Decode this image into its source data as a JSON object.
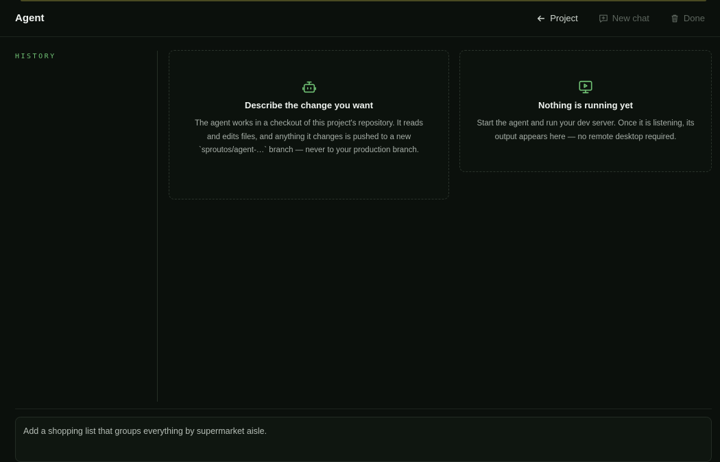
{
  "header": {
    "title": "Agent",
    "actions": {
      "project_label": "Project",
      "new_chat_label": "New chat",
      "done_label": "Done"
    }
  },
  "sidebar": {
    "history_label": "HISTORY"
  },
  "cards": {
    "describe": {
      "icon": "robot-icon",
      "title": "Describe the change you want",
      "body": "The agent works in a checkout of this project's repository. It reads and edits files, and anything it changes is pushed to a new `sproutos/agent-…` branch — never to your production branch."
    },
    "running": {
      "icon": "monitor-play-icon",
      "title": "Nothing is running yet",
      "body": "Start the agent and run your dev server. Once it is listening, its output appears here — no remote desktop required."
    }
  },
  "composer": {
    "value": "Add a shopping list that groups everything by supermarket aisle."
  },
  "colors": {
    "accent": "#6fbf73",
    "background": "#0b100c"
  }
}
